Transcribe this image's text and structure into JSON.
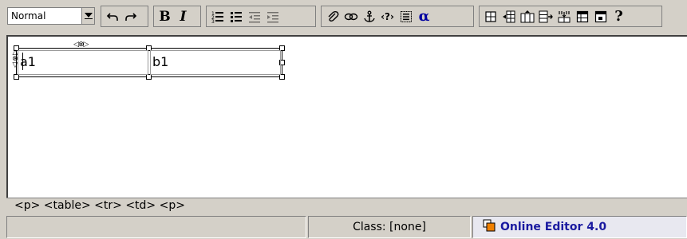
{
  "toolbar": {
    "style_select": {
      "value": "Normal"
    },
    "buttons": [
      {
        "name": "undo",
        "icon": "undo-icon"
      },
      {
        "name": "redo",
        "icon": "redo-icon"
      },
      {
        "name": "bold",
        "label": "B",
        "icon": "bold-icon"
      },
      {
        "name": "italic",
        "label": "I",
        "icon": "italic-icon"
      },
      {
        "name": "ordered-list",
        "icon": "ordered-list-icon"
      },
      {
        "name": "unordered-list",
        "icon": "unordered-list-icon"
      },
      {
        "name": "outdent",
        "icon": "outdent-icon",
        "disabled": true
      },
      {
        "name": "indent",
        "icon": "indent-icon",
        "disabled": true
      },
      {
        "name": "attachment",
        "icon": "paperclip-icon"
      },
      {
        "name": "link",
        "icon": "link-icon"
      },
      {
        "name": "anchor",
        "icon": "anchor-icon"
      },
      {
        "name": "code",
        "label": "‹?›",
        "icon": "code-icon"
      },
      {
        "name": "frame",
        "icon": "frame-icon"
      },
      {
        "name": "special-char",
        "label": "α",
        "icon": "alpha-icon"
      },
      {
        "name": "insert-table",
        "icon": "table-icon"
      },
      {
        "name": "insert-row",
        "icon": "insert-row-icon"
      },
      {
        "name": "insert-column",
        "icon": "insert-column-icon"
      },
      {
        "name": "split-cell",
        "icon": "split-cell-icon"
      },
      {
        "name": "merge-cell",
        "icon": "merge-cell-icon"
      },
      {
        "name": "table-properties",
        "icon": "table-properties-icon"
      },
      {
        "name": "cell-properties",
        "icon": "cell-properties-icon"
      },
      {
        "name": "help",
        "label": "?",
        "icon": "help-icon"
      }
    ]
  },
  "editor": {
    "table": {
      "cells": [
        "a1",
        "b1"
      ]
    }
  },
  "pathbar": {
    "path": "<p> <table> <tr> <td> <p>"
  },
  "statusbar": {
    "class_label": "Class: [none]",
    "brand": "Online Editor 4.0"
  },
  "colors": {
    "chrome": "#d4d0c8",
    "brand_text": "#1a1aa0",
    "brand_icon": "#f08000"
  }
}
